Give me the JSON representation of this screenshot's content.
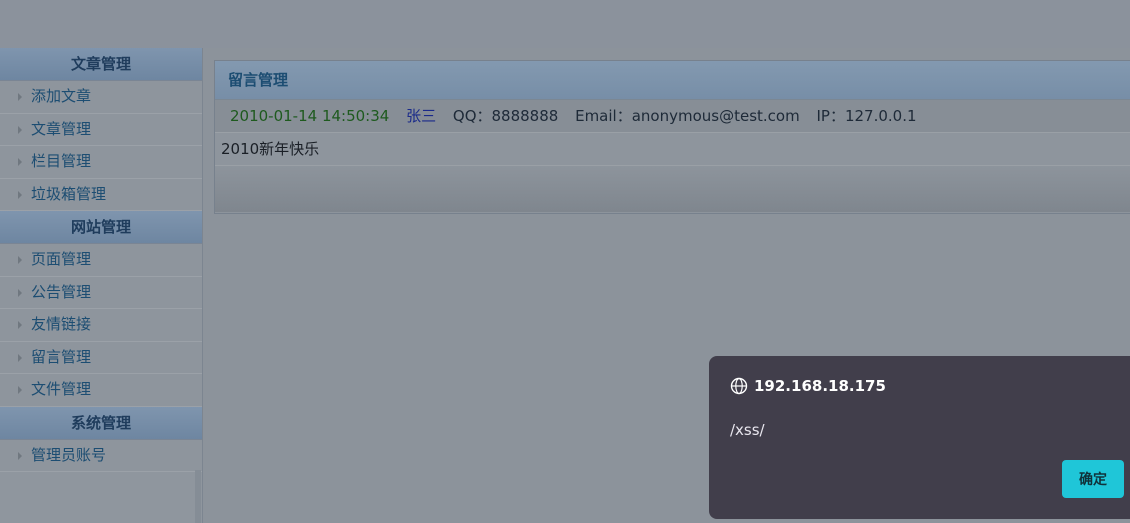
{
  "sidebar": {
    "sections": [
      {
        "title": "文章管理",
        "items": [
          "添加文章",
          "文章管理",
          "栏目管理",
          "垃圾箱管理"
        ]
      },
      {
        "title": "网站管理",
        "items": [
          "页面管理",
          "公告管理",
          "友情链接",
          "留言管理",
          "文件管理"
        ]
      },
      {
        "title": "系统管理",
        "items": [
          "管理员账号"
        ]
      }
    ]
  },
  "panel": {
    "title": "留言管理",
    "message": {
      "date": "2010-01-14 14:50:34",
      "author": "张三",
      "qq": "QQ：8888888",
      "email": "Email：anonymous@test.com",
      "ip": "IP：127.0.0.1",
      "content": "2010新年快乐"
    }
  },
  "dialog": {
    "origin": "192.168.18.175",
    "message": "/xss/",
    "ok_label": "确定"
  },
  "colors": {
    "dialog_bg": "#413e4b",
    "ok_button": "#1fc6d8",
    "date_text": "#1e5a1e",
    "author_text": "#1a2a8a"
  }
}
